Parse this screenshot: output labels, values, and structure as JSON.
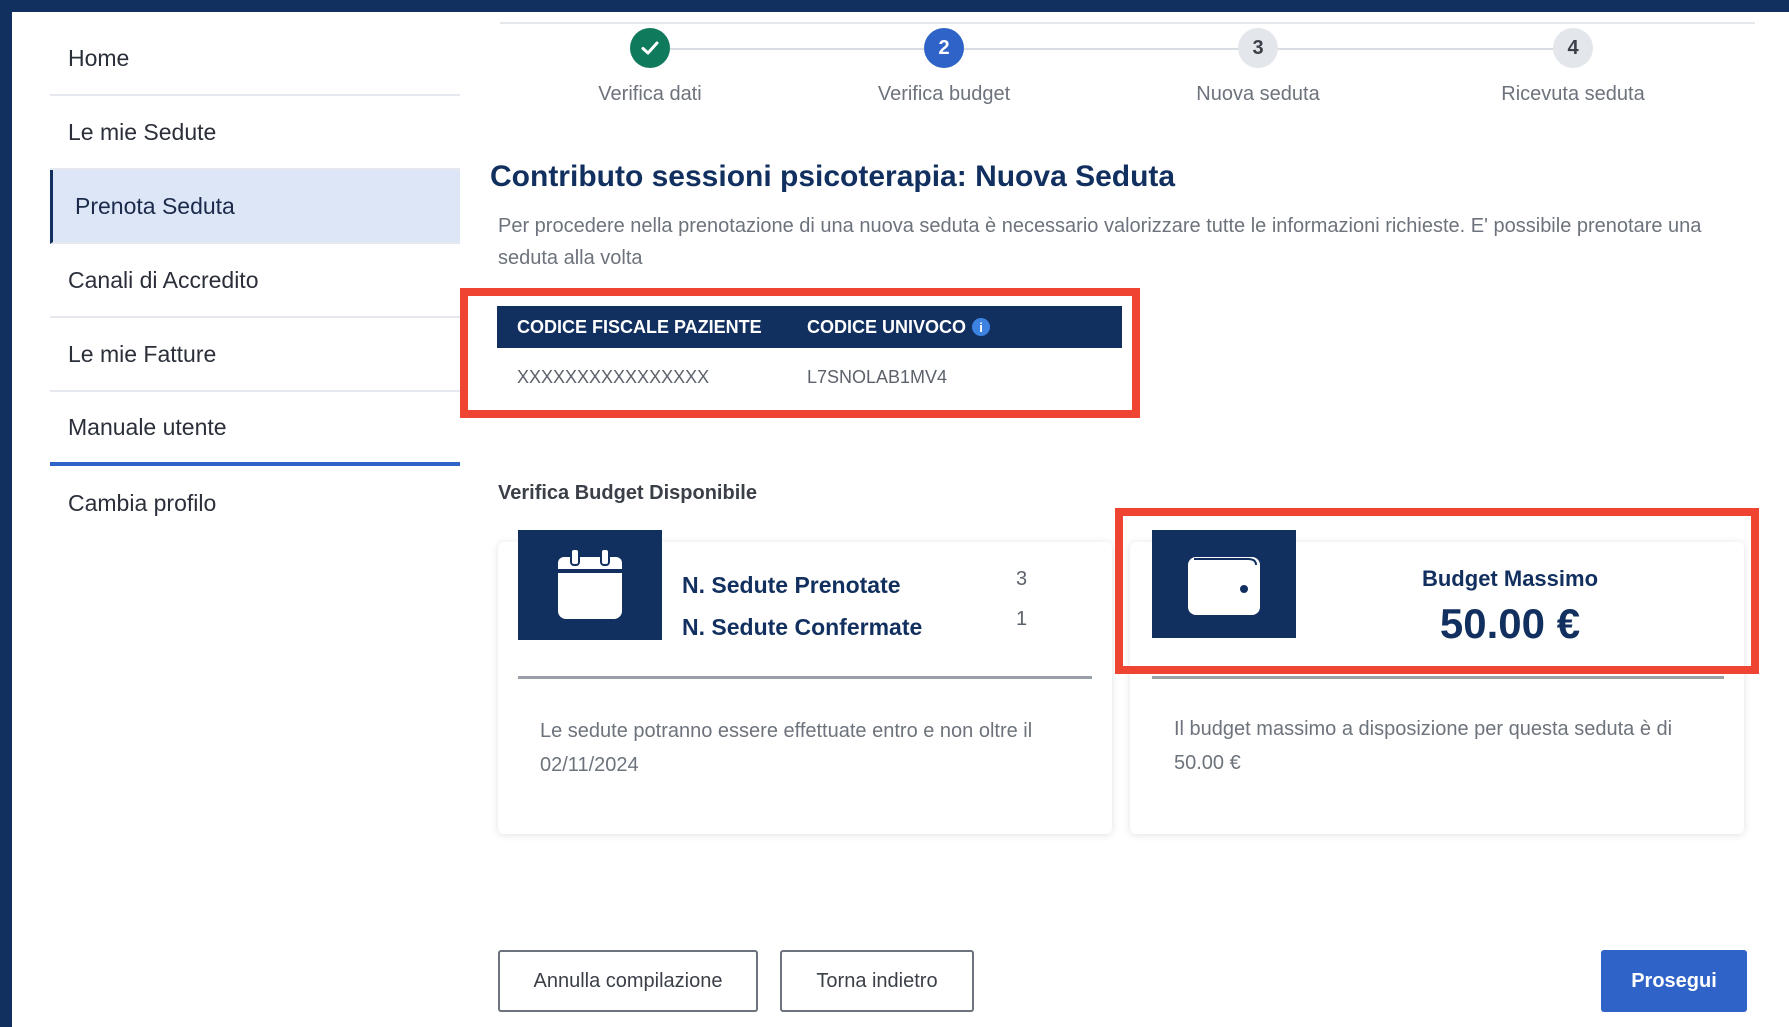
{
  "sidebar": {
    "items": [
      {
        "label": "Home"
      },
      {
        "label": "Le mie Sedute"
      },
      {
        "label": "Prenota Seduta"
      },
      {
        "label": "Canali di Accredito"
      },
      {
        "label": "Le mie Fatture"
      },
      {
        "label": "Manuale utente"
      },
      {
        "label": "Cambia profilo"
      }
    ],
    "active": "Prenota Seduta"
  },
  "stepper": {
    "steps": [
      {
        "number": "",
        "label": "Verifica dati",
        "state": "done",
        "icon": "check-icon"
      },
      {
        "number": "2",
        "label": "Verifica budget",
        "state": "current"
      },
      {
        "number": "3",
        "label": "Nuova seduta",
        "state": "todo"
      },
      {
        "number": "4",
        "label": "Ricevuta seduta",
        "state": "todo"
      }
    ]
  },
  "page": {
    "title": "Contributo sessioni psicoterapia: Nuova Seduta",
    "description": "Per procedere nella prenotazione di una nuova seduta è necessario valorizzare tutte le informazioni richieste. E' possibile prenotare una seduta alla volta"
  },
  "patient_table": {
    "headers": [
      "CODICE FISCALE PAZIENTE",
      "CODICE UNIVOCO"
    ],
    "row": [
      "XXXXXXXXXXXXXXXX",
      "L7SNOLAB1MV4"
    ]
  },
  "budget_section": {
    "title": "Verifica Budget Disponibile",
    "sessions_card": {
      "booked_label": "N. Sedute Prenotate",
      "booked_value": "3",
      "confirmed_label": "N. Sedute Confermate",
      "confirmed_value": "1",
      "note": "Le sedute potranno essere effettuate entro e non oltre il 02/11/2024",
      "icon": "calendar-icon"
    },
    "budget_card": {
      "label": "Budget Massimo",
      "value": "50.00 €",
      "note": "Il budget massimo a disposizione per questa seduta è di 50.00 €",
      "icon": "wallet-icon"
    }
  },
  "actions": {
    "cancel": "Annulla compilazione",
    "back": "Torna indietro",
    "next": "Prosegui"
  },
  "colors": {
    "navy": "#12305f",
    "primary": "#2f63c7",
    "success": "#0f7a5c",
    "highlight": "#f04432",
    "active_bg": "#dce6f6"
  }
}
